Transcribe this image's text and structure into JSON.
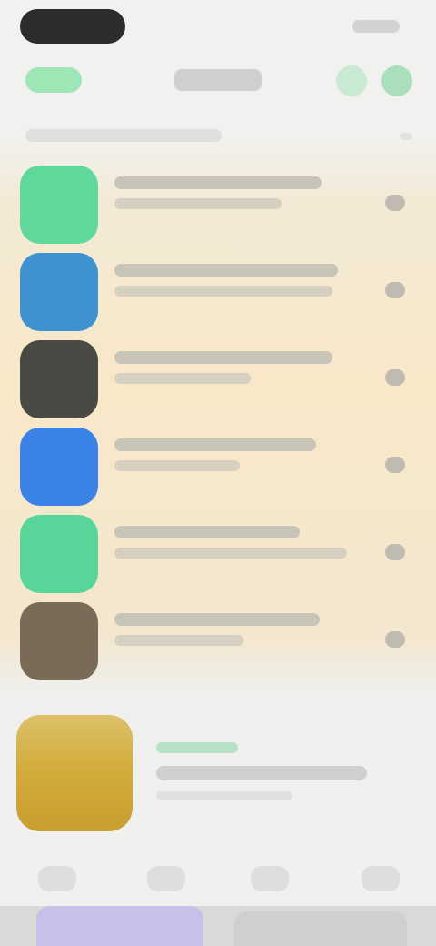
{
  "header": {
    "back_label": "",
    "title": "",
    "actions": [
      {
        "icon": "circle-icon"
      },
      {
        "icon": "circle-icon"
      }
    ]
  },
  "section": {
    "label": ""
  },
  "list": {
    "items": [
      {
        "name": "",
        "subtitle": "",
        "icon_color": "#5fd89b"
      },
      {
        "name": "",
        "subtitle": "",
        "icon_color": "#3e92cf"
      },
      {
        "name": "",
        "subtitle": "",
        "icon_color": "#4a4a44"
      },
      {
        "name": "",
        "subtitle": "",
        "icon_color": "#3b82e6"
      },
      {
        "name": "",
        "subtitle": "",
        "icon_color": "#58d69a"
      },
      {
        "name": "",
        "subtitle": "",
        "icon_color": "#7a6a58"
      }
    ]
  },
  "promo": {
    "tag": "",
    "title": "",
    "subtitle": "",
    "icon_color": "#d2ad3c"
  },
  "tabbar": {
    "tabs": [
      {
        "label": ""
      },
      {
        "label": ""
      },
      {
        "label": ""
      },
      {
        "label": ""
      }
    ]
  },
  "colors": {
    "accent_green": "#9fe6b6",
    "row_background": "#f8e8c8",
    "page_background": "#f0f0ef"
  }
}
